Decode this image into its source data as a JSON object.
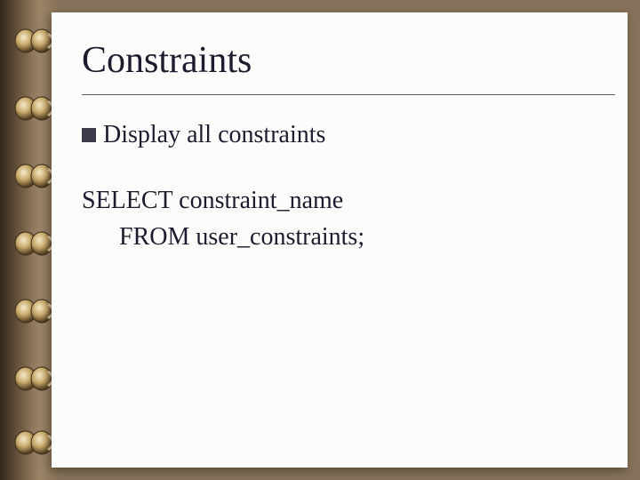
{
  "slide": {
    "title": "Constraints",
    "bullet": "Display all constraints",
    "code_line1": "SELECT constraint_name",
    "code_line2": "FROM user_constraints;"
  }
}
